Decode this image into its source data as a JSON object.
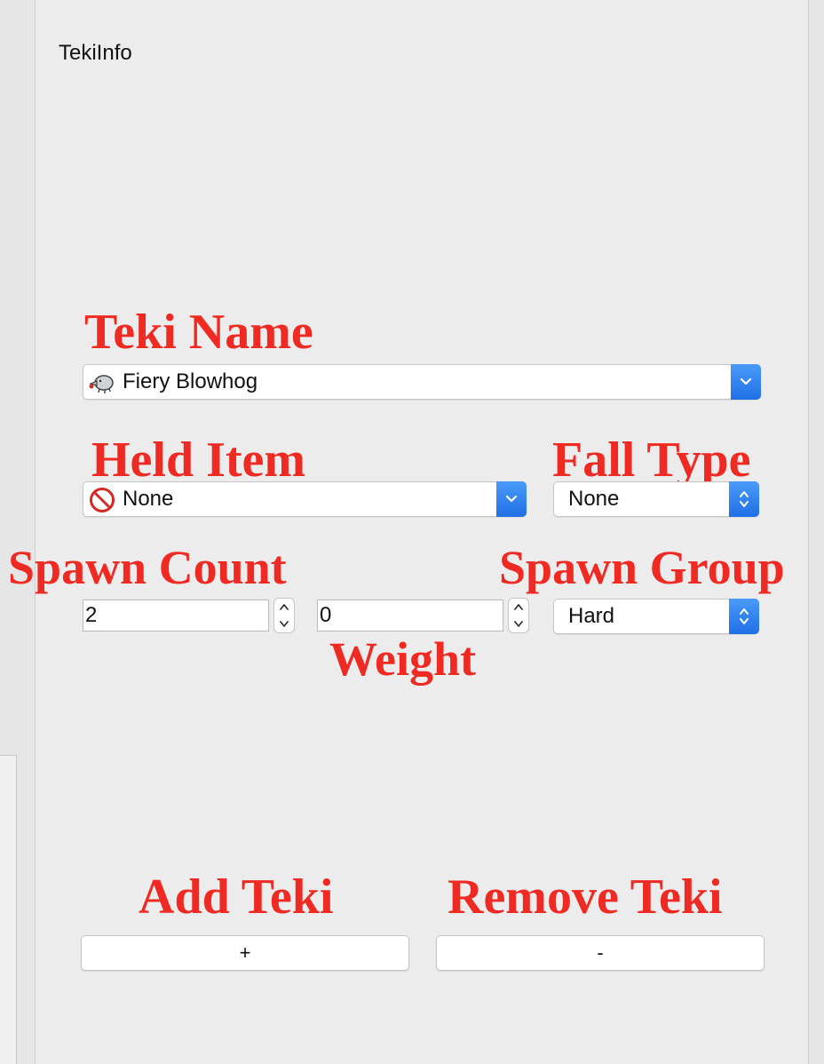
{
  "panel": {
    "title": "TekiInfo"
  },
  "annotations": {
    "teki_name": "Teki Name",
    "held_item": "Held Item",
    "fall_type": "Fall Type",
    "spawn_count": "Spawn Count",
    "spawn_group": "Spawn Group",
    "weight": "Weight",
    "add_teki": "Add Teki",
    "remove_teki": "Remove Teki"
  },
  "form": {
    "teki_name": {
      "value": "Fiery Blowhog",
      "icon": "blowhog-icon"
    },
    "held_item": {
      "value": "None",
      "icon": "prohibited-icon"
    },
    "fall_type": {
      "value": "None"
    },
    "spawn_count": {
      "value": "2"
    },
    "weight": {
      "value": "0"
    },
    "spawn_group": {
      "value": "Hard"
    }
  },
  "buttons": {
    "add_label": "+",
    "remove_label": "-"
  },
  "colors": {
    "annotation": "#ef2a23",
    "accent": "#2a7ff0",
    "background": "#ececec"
  }
}
